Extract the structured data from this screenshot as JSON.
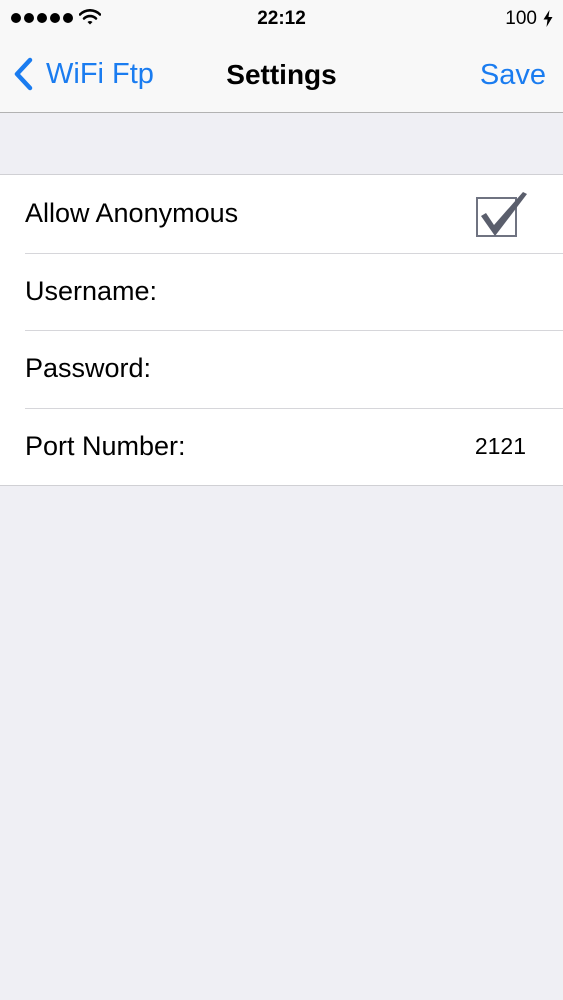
{
  "status_bar": {
    "time": "22:12",
    "battery": "100",
    "icons": [
      "signal-dots-icon",
      "wifi-icon",
      "bolt-icon"
    ]
  },
  "nav": {
    "back_label": "WiFi Ftp",
    "title": "Settings",
    "save_label": "Save",
    "accent_color": "#1a7cf0"
  },
  "settings": {
    "allow_anonymous": {
      "label": "Allow Anonymous",
      "checked": true
    },
    "username": {
      "label": "Username:",
      "value": ""
    },
    "password": {
      "label": "Password:",
      "value": ""
    },
    "port": {
      "label": "Port Number:",
      "value": "2121"
    }
  }
}
